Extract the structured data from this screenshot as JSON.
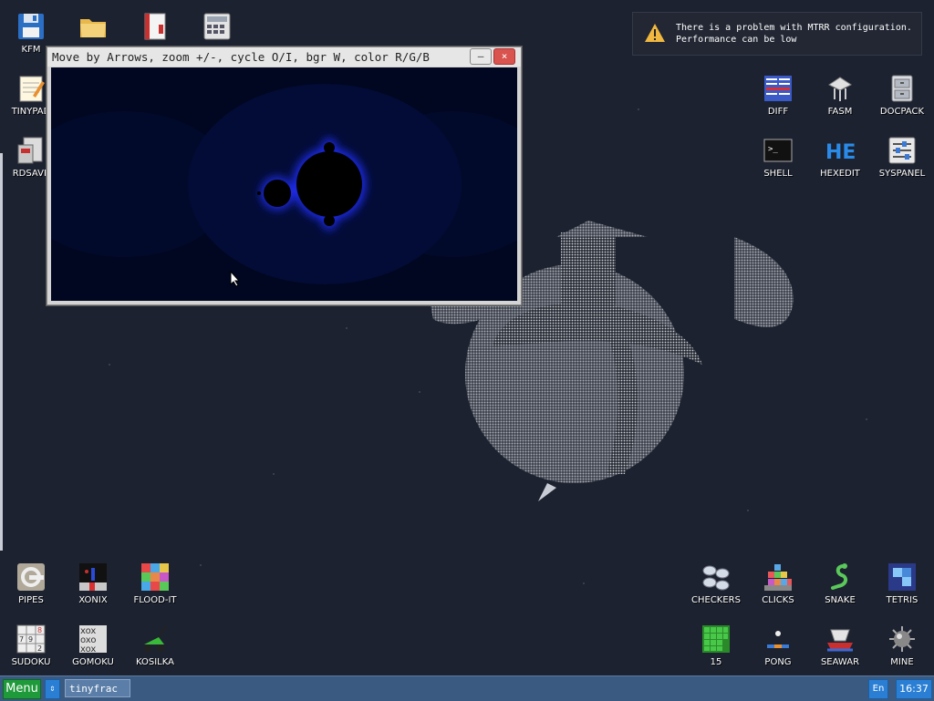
{
  "desktop": {
    "left_icons": [
      {
        "name": "kfm",
        "label": "KFM",
        "icon": "floppy-disk-icon"
      },
      {
        "name": "tinypad",
        "label": "TINYPAD",
        "icon": "notepad-icon"
      },
      {
        "name": "rdsave",
        "label": "RDSAVE",
        "icon": "rdsave-icon"
      },
      {
        "name": "folder",
        "label": "",
        "icon": "folder-icon"
      },
      {
        "name": "book",
        "label": "",
        "icon": "book-icon"
      },
      {
        "name": "calc",
        "label": "",
        "icon": "calculator-icon"
      }
    ],
    "right_icons": [
      {
        "name": "diff",
        "label": "DIFF",
        "icon": "diff-icon"
      },
      {
        "name": "fasm",
        "label": "FASM",
        "icon": "fasm-icon"
      },
      {
        "name": "docpack",
        "label": "DOCPACK",
        "icon": "docpack-icon"
      },
      {
        "name": "shell",
        "label": "SHELL",
        "icon": "terminal-icon"
      },
      {
        "name": "hexedit",
        "label": "HEXEDIT",
        "icon": "hexedit-icon"
      },
      {
        "name": "syspanel",
        "label": "SYSPANEL",
        "icon": "syspanel-icon"
      }
    ],
    "game_icons": [
      {
        "name": "pipes",
        "label": "PIPES",
        "icon": "pipes-icon"
      },
      {
        "name": "xonix",
        "label": "XONIX",
        "icon": "xonix-icon"
      },
      {
        "name": "flood-it",
        "label": "FLOOD-IT",
        "icon": "flood-it-icon"
      },
      {
        "name": "checkers",
        "label": "CHECKERS",
        "icon": "checkers-icon"
      },
      {
        "name": "clicks",
        "label": "CLICKS",
        "icon": "clicks-icon"
      },
      {
        "name": "snake",
        "label": "SNAKE",
        "icon": "snake-icon"
      },
      {
        "name": "tetris",
        "label": "TETRIS",
        "icon": "tetris-icon"
      },
      {
        "name": "sudoku",
        "label": "SUDOKU",
        "icon": "sudoku-icon"
      },
      {
        "name": "gomoku",
        "label": "GOMOKU",
        "icon": "gomoku-icon"
      },
      {
        "name": "kosilka",
        "label": "KOSILKA",
        "icon": "lawnmower-icon"
      },
      {
        "name": "fifteen",
        "label": "15",
        "icon": "fifteen-icon"
      },
      {
        "name": "pong",
        "label": "PONG",
        "icon": "pong-icon"
      },
      {
        "name": "seawar",
        "label": "SEAWAR",
        "icon": "seawar-icon"
      },
      {
        "name": "mine",
        "label": "MINE",
        "icon": "mine-icon"
      }
    ]
  },
  "window": {
    "title": "Move by Arrows, zoom +/-, cycle O/I, bgr W, color R/G/B",
    "minimize_glyph": "–",
    "close_glyph": "×"
  },
  "notification": {
    "message": "There is a problem with MTRR configuration.\nPerformance can be low"
  },
  "taskbar": {
    "menu_label": "Menu",
    "switch_glyph": "⇕",
    "task_item": "tinyfrac",
    "lang": "En",
    "clock": "16:37"
  },
  "colors": {
    "desktop_bg": "#1c2230",
    "taskbar": "#3a5a82",
    "menu_green": "#1f9a3a",
    "accent_blue": "#2a7fd4",
    "close_red": "#d9534f"
  }
}
